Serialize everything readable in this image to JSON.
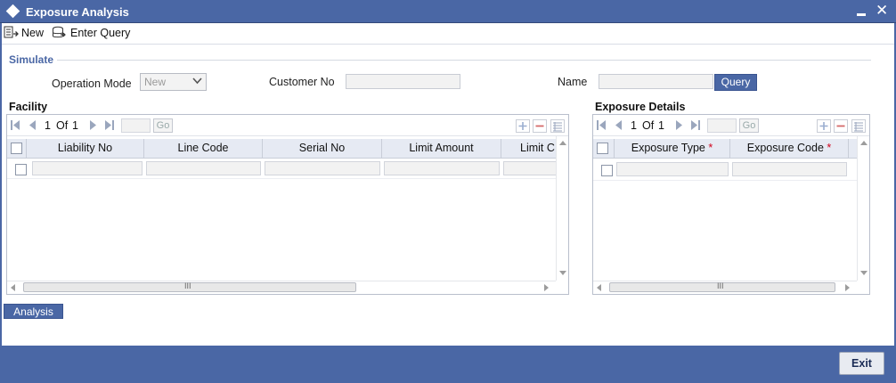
{
  "window": {
    "title": "Exposure Analysis"
  },
  "toolbar": {
    "new_label": "New",
    "enter_query_label": "Enter Query"
  },
  "simulate": {
    "section_title": "Simulate",
    "operation_mode_label": "Operation Mode",
    "operation_mode_value": "New",
    "customer_no_label": "Customer No",
    "customer_no_value": "",
    "name_label": "Name",
    "name_value": "",
    "query_label": "Query"
  },
  "facility": {
    "title": "Facility",
    "page_current": "1",
    "page_of": "Of",
    "page_total": "1",
    "go_label": "Go",
    "columns": [
      "Liability No",
      "Line Code",
      "Serial No",
      "Limit Amount",
      "Limit C"
    ]
  },
  "exposure": {
    "title": "Exposure Details",
    "page_current": "1",
    "page_of": "Of",
    "page_total": "1",
    "go_label": "Go",
    "columns": [
      "Exposure Type",
      "Exposure Code"
    ],
    "required_marker": "*"
  },
  "analysis_label": "Analysis",
  "exit_label": "Exit",
  "scroll_grip": "III",
  "colors": {
    "accent": "#4a67a5",
    "header_bg": "#e6eaf3",
    "required": "#d0021b"
  }
}
